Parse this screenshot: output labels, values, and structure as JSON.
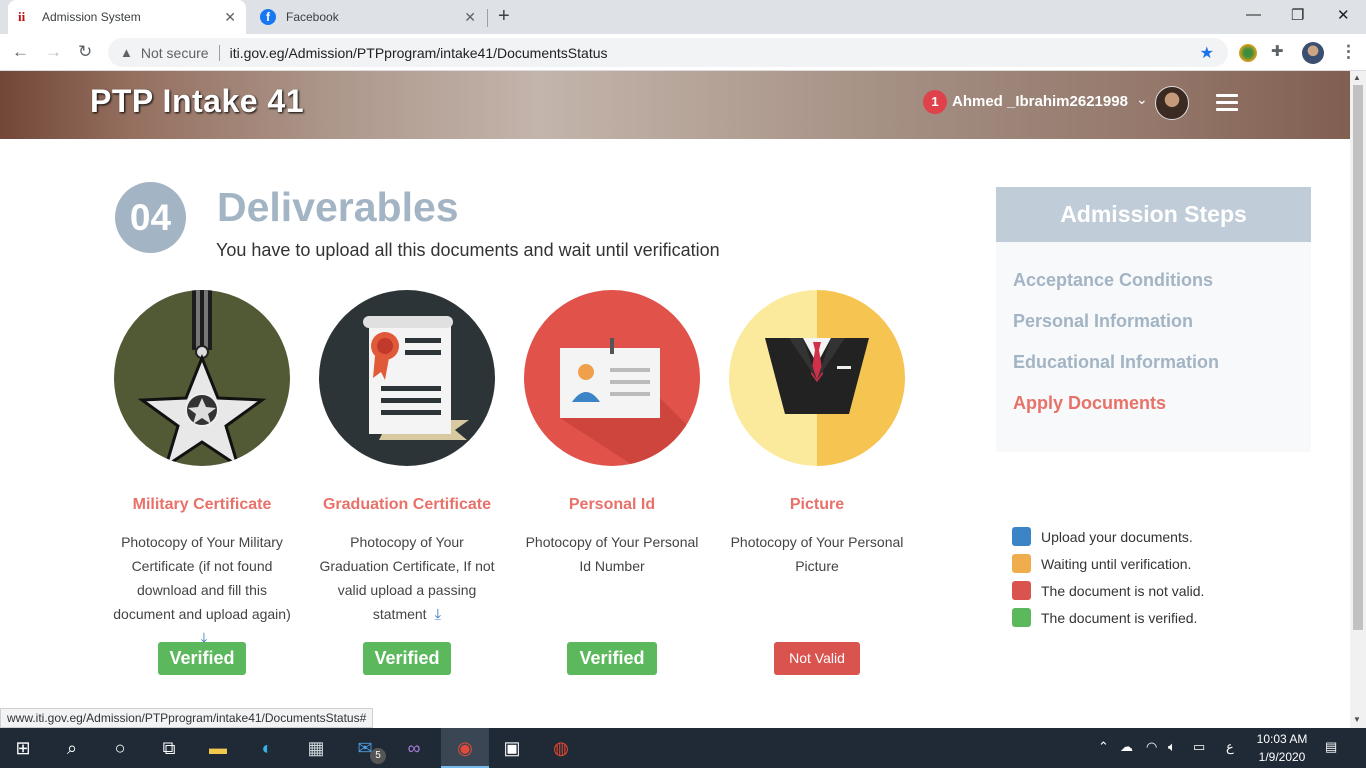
{
  "browser": {
    "tabs": [
      {
        "title": "Admission System",
        "active": true
      },
      {
        "title": "Facebook",
        "active": false
      }
    ],
    "security_label": "Not secure",
    "url": "iti.gov.eg/Admission/PTPprogram/intake41/DocumentsStatus",
    "status_url": "www.iti.gov.eg/Admission/PTPprogram/intake41/DocumentsStatus#"
  },
  "header": {
    "brand": "PTP Intake 41",
    "notification_count": "1",
    "username": "Ahmed _Ibrahim2621998"
  },
  "main": {
    "step_number": "04",
    "title": "Deliverables",
    "subtitle": "You have to upload all this documents and wait until verification",
    "documents": [
      {
        "name": "Military Certificate",
        "description": "Photocopy of Your Military Certificate (if not found download and fill this document and upload again)",
        "status": "Verified",
        "status_color": "#5cb85c",
        "has_download": true,
        "icon": "military-medal-icon"
      },
      {
        "name": "Graduation Certificate",
        "description": "Photocopy of Your Graduation Certificate, If not valid upload a passing statment",
        "status": "Verified",
        "status_color": "#5cb85c",
        "has_download": true,
        "icon": "diploma-scroll-icon"
      },
      {
        "name": "Personal Id",
        "description": "Photocopy of Your Personal Id Number",
        "status": "Verified",
        "status_color": "#5cb85c",
        "has_download": false,
        "icon": "id-card-icon"
      },
      {
        "name": "Picture",
        "description": "Photocopy of Your Personal Picture",
        "status": "Not Valid",
        "status_color": "#d9534f",
        "has_download": false,
        "icon": "suit-portrait-icon"
      }
    ]
  },
  "sidebar": {
    "title": "Admission Steps",
    "steps": [
      {
        "label": "Acceptance Conditions",
        "active": false
      },
      {
        "label": "Personal Information",
        "active": false
      },
      {
        "label": "Educational Information",
        "active": false
      },
      {
        "label": "Apply Documents",
        "active": true
      }
    ],
    "legend": [
      {
        "label": "Upload your documents.",
        "color": "#3b84c6"
      },
      {
        "label": "Waiting until verification.",
        "color": "#f0ad4e"
      },
      {
        "label": "The document is not valid.",
        "color": "#d9534f"
      },
      {
        "label": "The document is verified.",
        "color": "#5cb85c"
      }
    ]
  },
  "taskbar": {
    "time": "10:03 AM",
    "date": "1/9/2020",
    "language": "ع",
    "mail_badge": "5"
  }
}
